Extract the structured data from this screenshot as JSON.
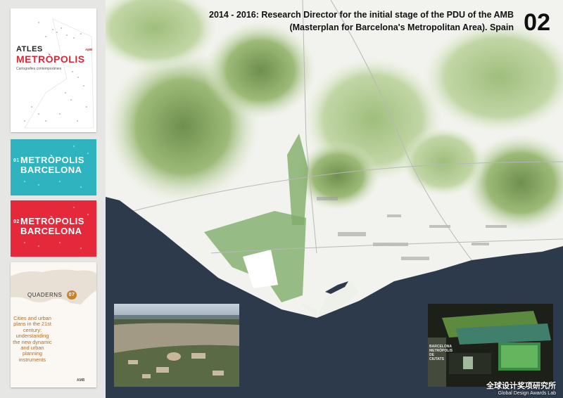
{
  "header": {
    "title_line1": "2014 - 2016: Research Director for the initial stage of the PDU of the AMB",
    "title_line2": "(Masterplan for Barcelona's Metropolitan Area). Spain",
    "number": "02"
  },
  "covers": {
    "atles": {
      "line1": "ATLES",
      "line2": "METRÒPOLIS",
      "subtitle": "Cartografies contemporànies",
      "logo": "AMB"
    },
    "blue": {
      "num": "01",
      "line1": "METRÒPOLIS",
      "line2": "BARCELONA"
    },
    "red": {
      "num": "02",
      "line1": "METRÒPOLIS",
      "line2": "BARCELONA"
    },
    "quaderns": {
      "name": "QUADERNS",
      "number": "07",
      "main_text": "Cities and urban plans in the 21st century: understanding the new dynamic and urban planning instruments",
      "logo": "AMB"
    }
  },
  "exhibition": {
    "wall_text": "BARCELONA METRÒPOLIS DE CIUTATS"
  },
  "watermark": {
    "line1": "全球设计奖项研究所",
    "line2": "Global Design Awards Lab"
  },
  "colors": {
    "sea": "#2c3a4c",
    "relief": "#8fae6a",
    "teal_cover": "#2fb3bf",
    "red_cover": "#e5283a"
  }
}
